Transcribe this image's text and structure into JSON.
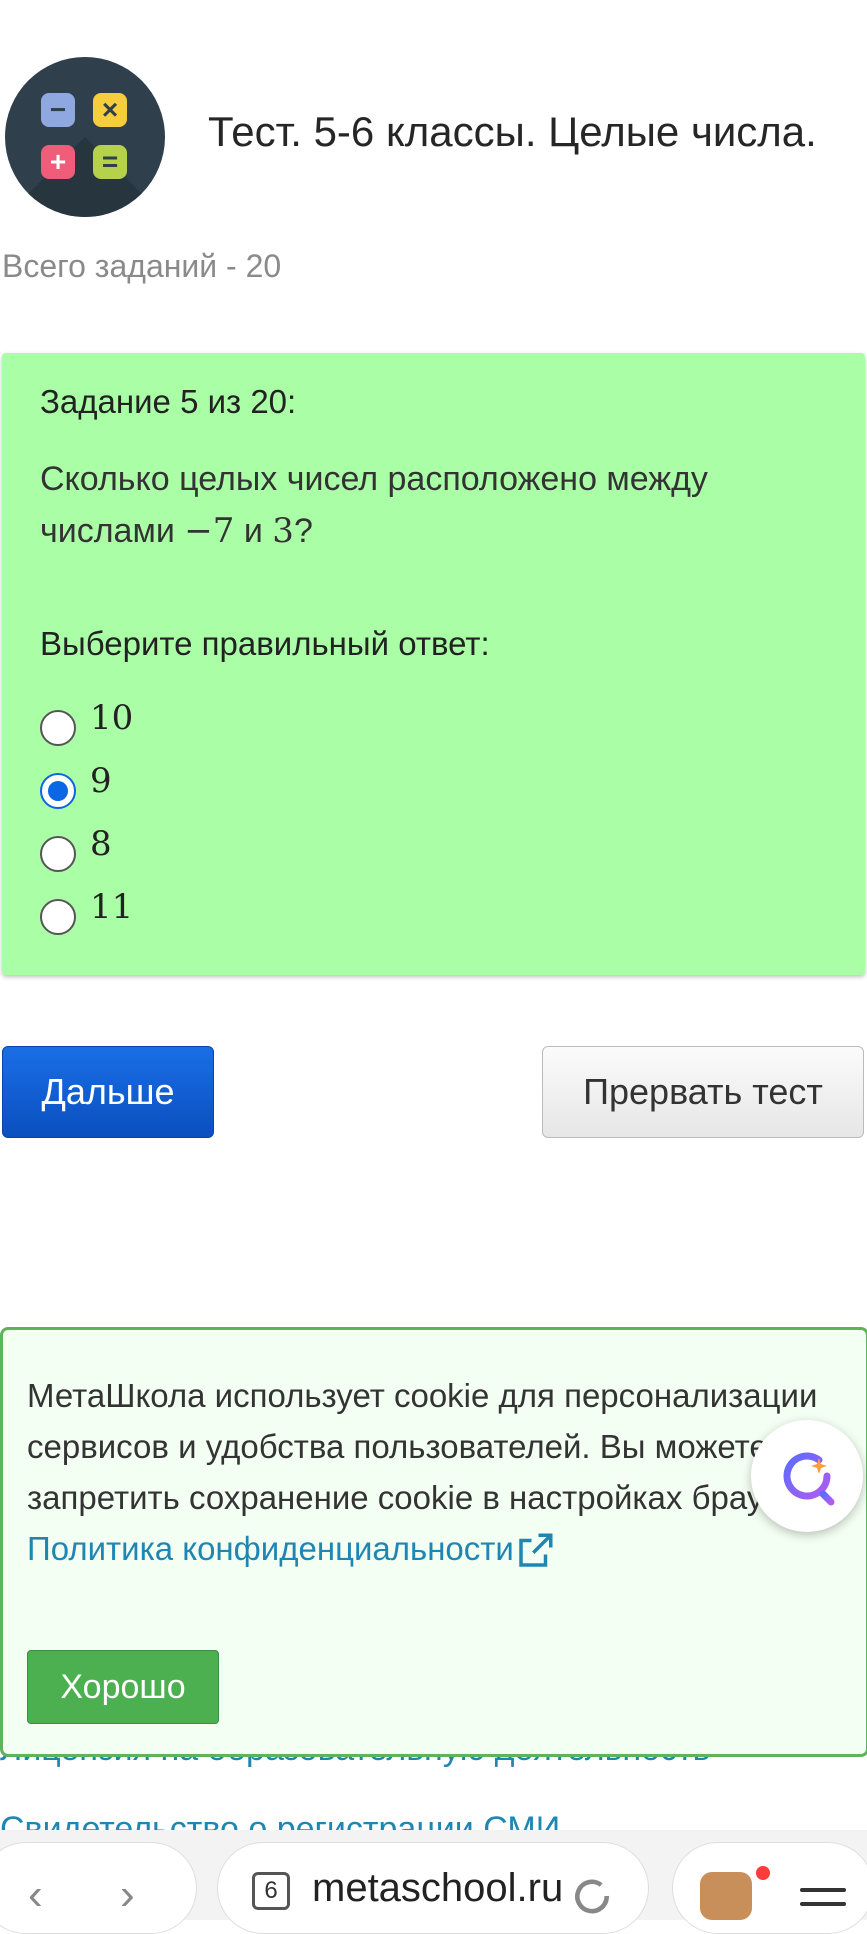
{
  "header": {
    "title": "Тест. 5-6 классы. Целые числа.",
    "total": "Всего заданий - 20"
  },
  "logo": {
    "tiles": [
      "−",
      "×",
      "+",
      "="
    ]
  },
  "task": {
    "number": "Задание 5 из 20:",
    "question_pre": "Сколько целых чисел расположено между числами ",
    "num_a": "−7",
    "mid": " и ",
    "num_b": "3",
    "end": "?",
    "prompt": "Выберите правильный ответ:",
    "options": [
      {
        "label": "10",
        "selected": false
      },
      {
        "label": "9",
        "selected": true
      },
      {
        "label": "8",
        "selected": false
      },
      {
        "label": "11",
        "selected": false
      }
    ]
  },
  "buttons": {
    "next": "Дальше",
    "abort": "Прервать тест"
  },
  "footer": {
    "license": "Лицензия на образовательную деятельность",
    "certificate": "Свидетельство о регистрации СМИ"
  },
  "cookie": {
    "text": "МетаШкола использует cookie для персонализации сервисов и удобства пользователей. Вы можете запретить сохранение cookie в настройках браузера. ",
    "link": "Политика конфиденциальности",
    "ok": "Хорошо"
  },
  "browser": {
    "tab_count": "6",
    "url": "metaschool.ru"
  },
  "colors": {
    "card": "#aaffa6",
    "primary": "#0a4fc0",
    "cookie_accent": "#4caf50",
    "link": "#1f86b4"
  }
}
